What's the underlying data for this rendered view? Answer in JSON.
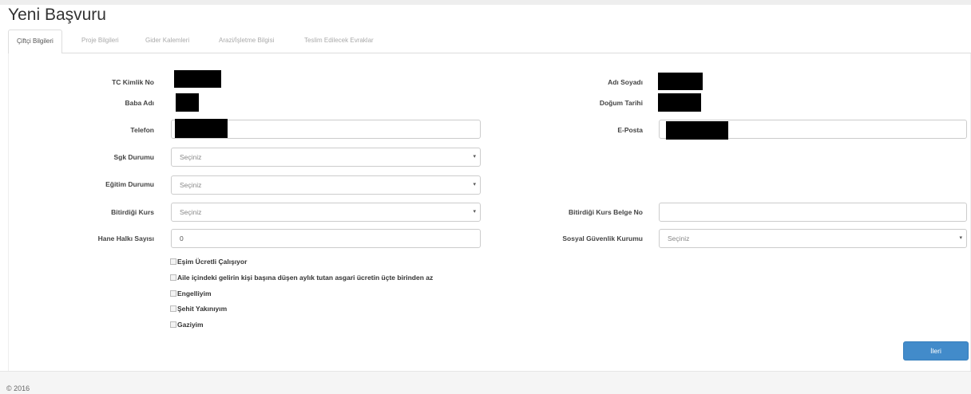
{
  "page_title": "Yeni Başvuru",
  "tabs": [
    {
      "label": "Çiftçi Bilgileri",
      "active": true
    },
    {
      "label": "Proje Bilgileri",
      "active": false
    },
    {
      "label": "Gider Kalemleri",
      "active": false
    },
    {
      "label": "Arazi/İşletme Bilgisi",
      "active": false
    },
    {
      "label": "Teslim Edilecek Evraklar",
      "active": false
    }
  ],
  "form": {
    "tc_kimlik_label": "TC Kimlik No",
    "baba_adi_label": "Baba Adı",
    "telefon_label": "Telefon",
    "sgk_label": "Sgk Durumu",
    "egitim_label": "Eğitim Durumu",
    "kurs_label": "Bitirdiği Kurs",
    "hane_label": "Hane Halkı Sayısı",
    "ad_soyad_label": "Adı Soyadı",
    "dogum_label": "Doğum Tarihi",
    "eposta_label": "E-Posta",
    "kurs_belge_label": "Bitirdiği Kurs Belge No",
    "sosyal_label": "Sosyal Güvenlik Kurumu",
    "sgk_value": "Seçiniz",
    "egitim_value": "Seçiniz",
    "kurs_value": "Seçiniz",
    "sosyal_value": "Seçiniz",
    "hane_value": "0",
    "kurs_belge_value": ""
  },
  "checkboxes": [
    "Eşim Ücretli Çalışıyor",
    "Aile içindeki gelirin kişi başına düşen aylık tutan asgari ücretin üçte birinden az",
    "Engelliyim",
    "Şehit Yakınıyım",
    "Gaziyim"
  ],
  "next_button": "İleri",
  "footer": "© 2016",
  "colors": {
    "primary_button": "#428bca",
    "redaction": "#000000"
  }
}
